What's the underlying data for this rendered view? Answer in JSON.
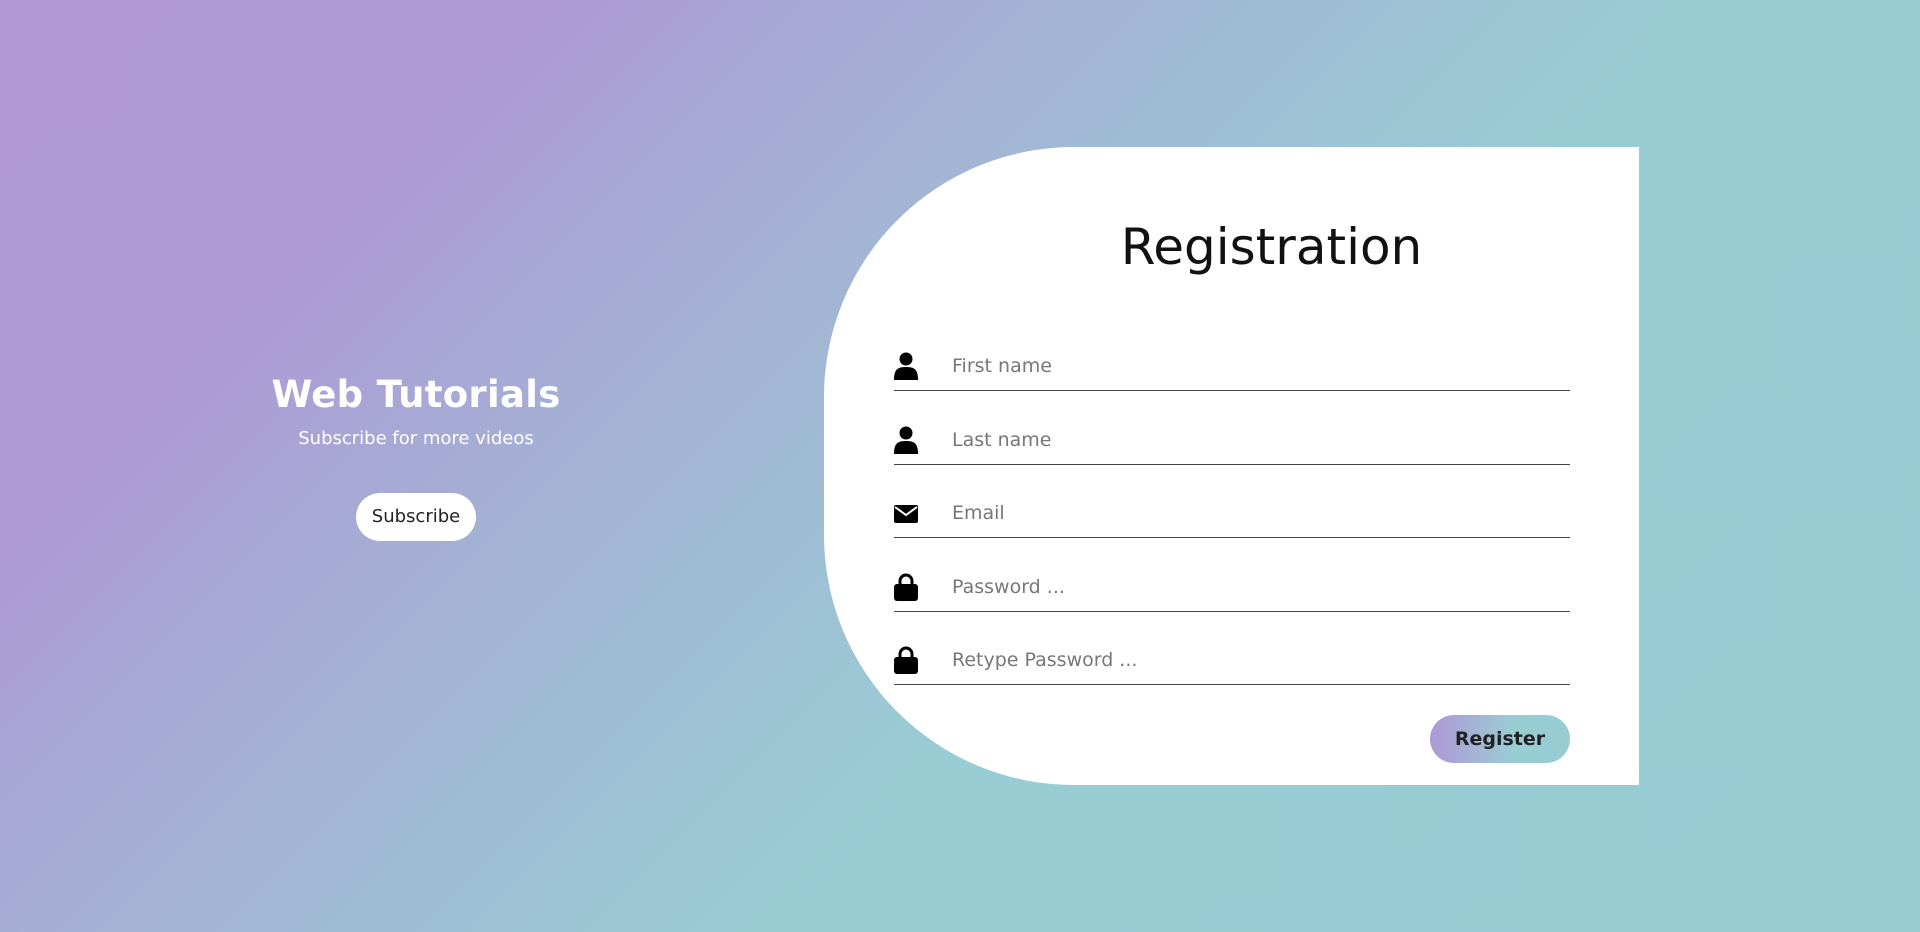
{
  "brand": {
    "title": "Web Tutorials",
    "subtitle": "Subscribe for more videos",
    "subscribe_label": "Subscribe"
  },
  "form": {
    "title": "Registration",
    "fields": [
      {
        "name": "first-name",
        "placeholder": "First name",
        "icon": "user-icon"
      },
      {
        "name": "last-name",
        "placeholder": "Last name",
        "icon": "user-icon"
      },
      {
        "name": "email",
        "placeholder": "Email",
        "icon": "envelope-icon"
      },
      {
        "name": "password",
        "placeholder": "Password ...",
        "icon": "lock-icon"
      },
      {
        "name": "retype-password",
        "placeholder": "Retype Password ...",
        "icon": "lock-icon"
      }
    ],
    "register_label": "Register"
  },
  "colors": {
    "gradient_start": "#b097d6",
    "gradient_end": "#97ccd3",
    "card_background": "#ffffff"
  }
}
